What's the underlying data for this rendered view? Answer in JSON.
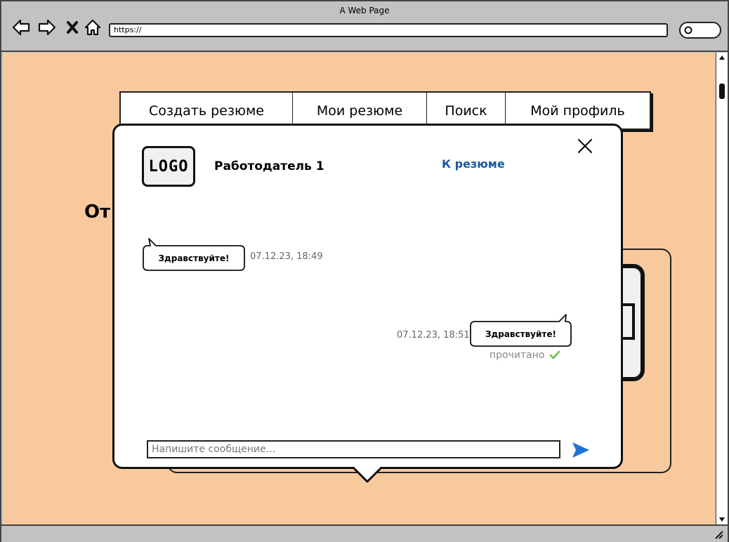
{
  "window": {
    "title": "A Web Page",
    "url": "https://"
  },
  "nav": {
    "tabs": [
      {
        "label": "Создать резюме"
      },
      {
        "label": "Мои резюме"
      },
      {
        "label": "Поиск"
      },
      {
        "label": "Мой профиль"
      }
    ]
  },
  "background": {
    "heading_fragment": "От"
  },
  "chat": {
    "logo_text": "LOGO",
    "employer_name": "Работодатель 1",
    "to_resume_link": "К резюме",
    "messages": [
      {
        "direction": "incoming",
        "text": "Здравствуйте!",
        "timestamp": "07.12.23, 18:49"
      },
      {
        "direction": "outgoing",
        "text": "Здравствуйте!",
        "timestamp": "07.12.23, 18:51",
        "status": "прочитано"
      }
    ],
    "input_placeholder": "Напишите сообщение...",
    "icons": {
      "close": "close-icon",
      "send": "send-icon",
      "read": "checkmark-icon"
    }
  },
  "colors": {
    "page_background": "#f8c99c",
    "link": "#1a5aa0",
    "send_icon": "#1e72d8",
    "read_check": "#6cc04a"
  }
}
